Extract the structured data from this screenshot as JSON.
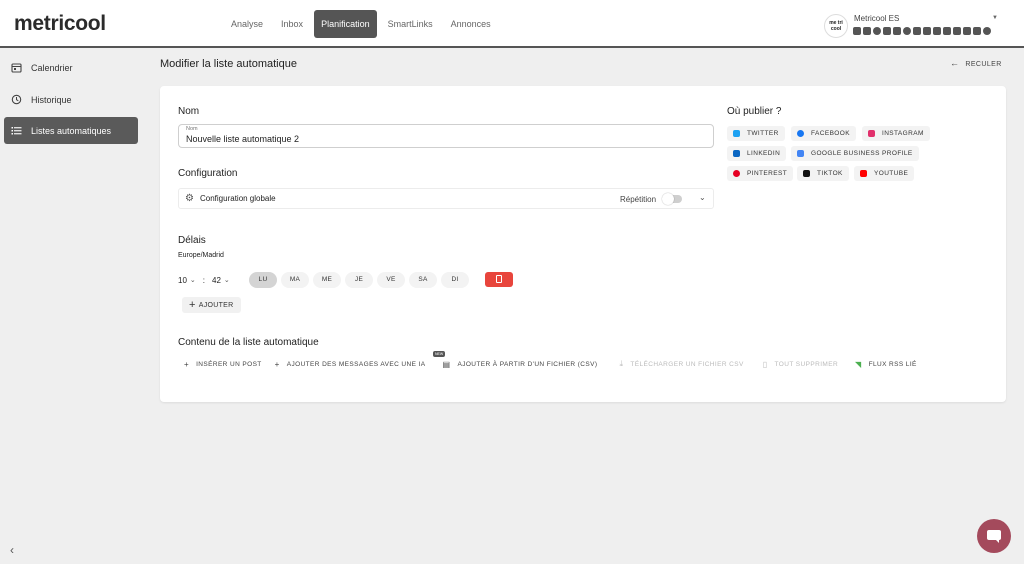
{
  "brand": {
    "logo": "metricool",
    "accent": "#555555",
    "danger": "#e8453c",
    "chat_color": "#a44a5c"
  },
  "nav": {
    "items": [
      "Analyse",
      "Inbox",
      "Planification",
      "SmartLinks",
      "Annonces"
    ],
    "active_index": 2
  },
  "account": {
    "avatar_text": "me tri cool",
    "name": "Metricool ES"
  },
  "sidebar": {
    "items": [
      "Calendrier",
      "Historique",
      "Listes automatiques"
    ],
    "active_index": 2
  },
  "page": {
    "title": "Modifier la liste automatique",
    "back_label": "RECULER"
  },
  "form": {
    "name_section": "Nom",
    "name_field_label": "Nom",
    "name_value": "Nouvelle liste automatique 2",
    "config_section": "Configuration",
    "config_label": "Configuration globale",
    "repetition_label": "Répétition",
    "repetition_enabled": false,
    "delays_section": "Délais",
    "timezone": "Europe/Madrid",
    "hour": "10",
    "minute": "42",
    "time_separator": ":",
    "days": [
      "LU",
      "MA",
      "ME",
      "JE",
      "VE",
      "SA",
      "DI"
    ],
    "active_days": [
      "LU"
    ],
    "add_label": "AJOUTER",
    "content_section": "Contenu de la liste automatique"
  },
  "content_actions": [
    {
      "label": "INSÉRER UN POST",
      "icon": "plus-icon",
      "enabled": true
    },
    {
      "label": "AJOUTER DES MESSAGES AVEC UNE IA",
      "icon": "plus-icon",
      "enabled": true,
      "badge": "NEW"
    },
    {
      "label": "AJOUTER À PARTIR D'UN FICHIER (CSV)",
      "icon": "file-import-icon",
      "enabled": true
    },
    {
      "label": "TÉLÉCHARGER UN FICHIER CSV",
      "icon": "download-icon",
      "enabled": false
    },
    {
      "label": "TOUT SUPPRIMER",
      "icon": "trash-icon",
      "enabled": false
    },
    {
      "label": "FLUX RSS LIÉ",
      "icon": "rss-icon",
      "enabled": true
    }
  ],
  "publish": {
    "title": "Où publier ?",
    "networks": [
      {
        "label": "TWITTER",
        "icon": "twitter-icon",
        "color": "#1da1f2"
      },
      {
        "label": "FACEBOOK",
        "icon": "facebook-icon",
        "color": "#1877f2"
      },
      {
        "label": "INSTAGRAM",
        "icon": "instagram-icon",
        "color": "#e1306c"
      },
      {
        "label": "LINKEDIN",
        "icon": "linkedin-icon",
        "color": "#0a66c2"
      },
      {
        "label": "GOOGLE BUSINESS PROFILE",
        "icon": "google-business-icon",
        "color": "#4285f4"
      },
      {
        "label": "PINTEREST",
        "icon": "pinterest-icon",
        "color": "#e60023"
      },
      {
        "label": "TIKTOK",
        "icon": "tiktok-icon",
        "color": "#111111"
      },
      {
        "label": "YOUTUBE",
        "icon": "youtube-icon",
        "color": "#ff0000"
      }
    ]
  }
}
